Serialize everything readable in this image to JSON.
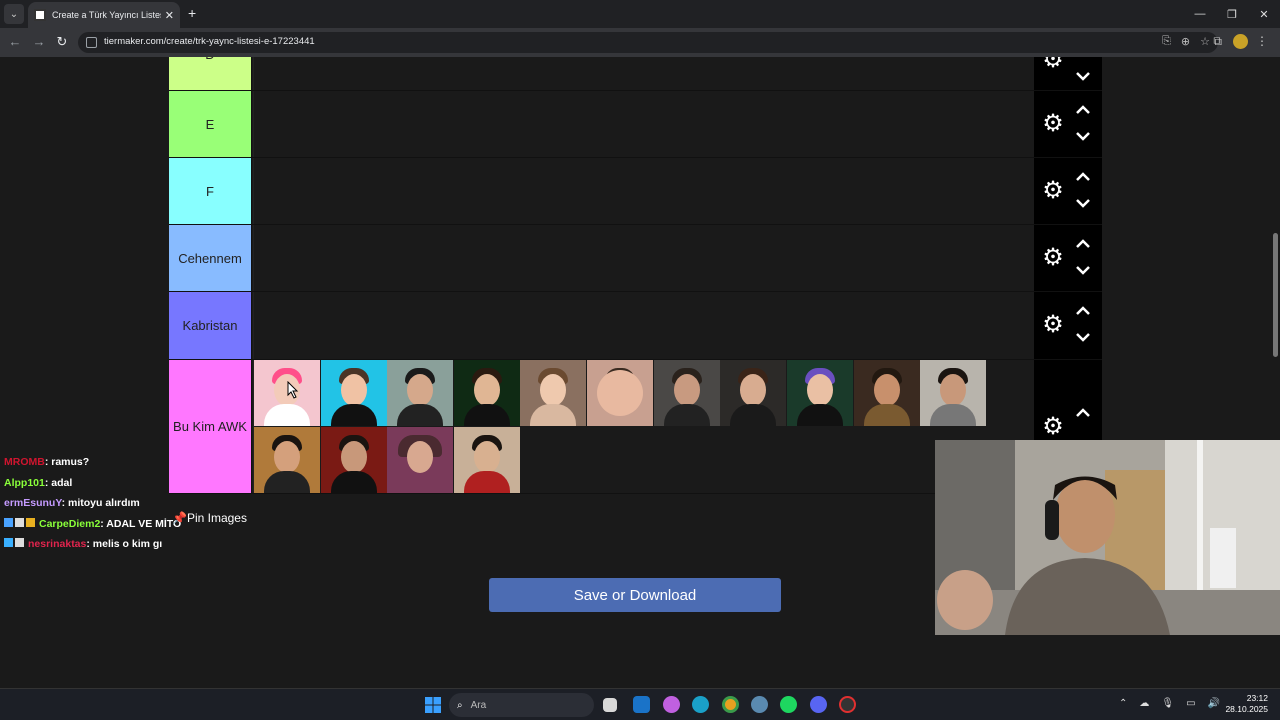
{
  "browser": {
    "tab_title": "Create a Türk Yayıncı Listesi E.Ş",
    "url": "tiermaker.com/create/trk-yaync-listesi-e-17223441"
  },
  "tiers": [
    {
      "label": "D",
      "color": "#ccff88"
    },
    {
      "label": "E",
      "color": "#99ff77"
    },
    {
      "label": "F",
      "color": "#88ffff"
    },
    {
      "label": "Cehennem",
      "color": "#88bbff"
    },
    {
      "label": "Kabristan",
      "color": "#7777ff"
    },
    {
      "label": "Bu Kim AWK",
      "color": "#ff77ff"
    }
  ],
  "chat": [
    {
      "user": "MROMB",
      "user_color": "#d0152f",
      "msg": ": ramus?"
    },
    {
      "user": "Alpp101",
      "user_color": "#8aff3a",
      "msg": ": adal"
    },
    {
      "user": "ermEsunuY",
      "user_color": "#c59bff",
      "msg": ": mitoyu alırdım"
    },
    {
      "user": "CarpeDiem2",
      "user_color": "#8aff3a",
      "msg": ": ADAL VE MİTO"
    },
    {
      "user": "nesrinaktas",
      "user_color": "#e0244d",
      "msg": ": melis o kim gı"
    }
  ],
  "pin_images_label": "Pin Images",
  "save_button_label": "Save or Download",
  "taskbar": {
    "search_placeholder": "Ara",
    "time": "23:12",
    "date": "28.10.2025"
  }
}
